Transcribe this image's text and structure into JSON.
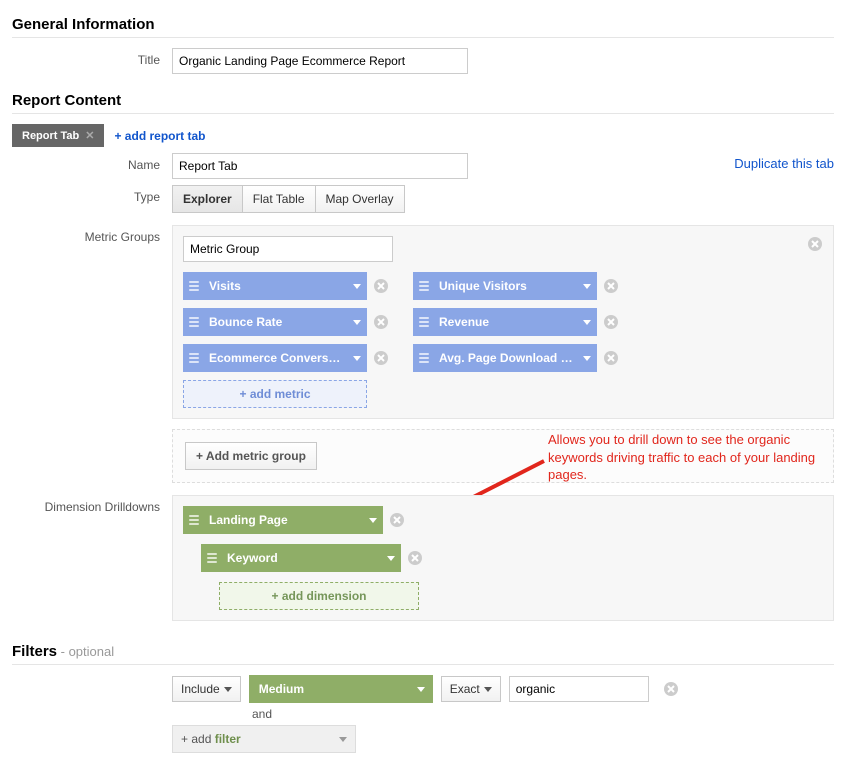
{
  "general": {
    "heading": "General Information",
    "title_label": "Title",
    "title_value": "Organic Landing Page Ecommerce Report"
  },
  "report": {
    "heading": "Report Content",
    "active_tab_label": "Report Tab",
    "add_report_tab": "+ add report tab",
    "name_label": "Name",
    "name_value": "Report Tab",
    "duplicate_link": "Duplicate this tab",
    "type_label": "Type",
    "type_options": [
      "Explorer",
      "Flat Table",
      "Map Overlay"
    ]
  },
  "metrics": {
    "label": "Metric Groups",
    "group_name_value": "Metric Group",
    "rows": [
      [
        "Visits",
        "Unique Visitors"
      ],
      [
        "Bounce Rate",
        "Revenue"
      ],
      [
        "Ecommerce Conversion …",
        "Avg. Page Download Ti…"
      ]
    ],
    "add_metric": "+ add metric",
    "add_metric_group": "+ Add metric group"
  },
  "dimensions": {
    "label": "Dimension Drilldowns",
    "lvl1": "Landing Page",
    "lvl2": "Keyword",
    "add_dimension": "+ add dimension",
    "annotation": "Allows you to drill down to see the organic keywords driving traffic to each of your landing pages."
  },
  "filters": {
    "heading": "Filters",
    "optional": " - optional",
    "include": "Include",
    "dimension": "Medium",
    "match": "Exact",
    "value": "organic",
    "and": "and",
    "add_filter_prefix": "+ add ",
    "add_filter_word": "filter"
  }
}
